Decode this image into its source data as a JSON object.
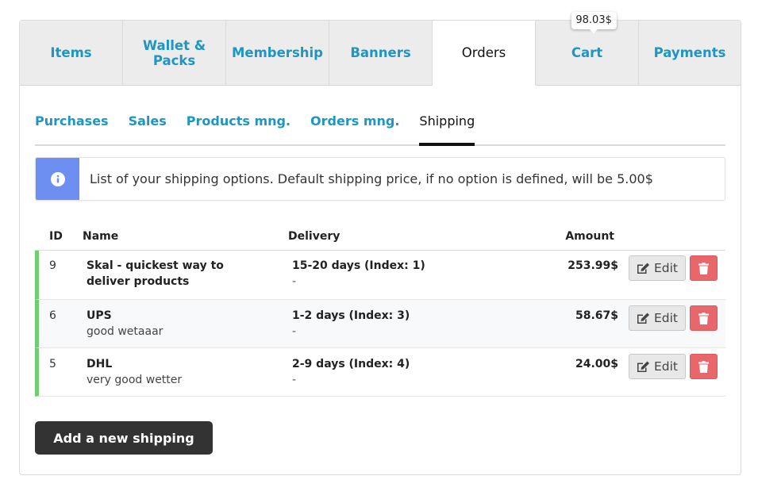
{
  "tabs": [
    {
      "label": "Items"
    },
    {
      "label": "Wallet & Packs"
    },
    {
      "label": "Membership"
    },
    {
      "label": "Banners"
    },
    {
      "label": "Orders"
    },
    {
      "label": "Cart"
    },
    {
      "label": "Payments"
    }
  ],
  "active_tab": "Orders",
  "cart_badge": "98.03$",
  "subtabs": [
    {
      "label": "Purchases"
    },
    {
      "label": "Sales"
    },
    {
      "label": "Products mng."
    },
    {
      "label": "Orders mng."
    },
    {
      "label": "Shipping"
    }
  ],
  "active_subtab": "Shipping",
  "info": {
    "icon": "info-circle-icon",
    "text": "List of your shipping options. Default shipping price, if no option is defined, will be 5.00$"
  },
  "table": {
    "headers": {
      "id": "ID",
      "name": "Name",
      "delivery": "Delivery",
      "amount": "Amount"
    },
    "rows": [
      {
        "id": "9",
        "name": "Skal - quickest way to deliver products",
        "description": "",
        "delivery": "15-20 days (Index: 1)",
        "delivery_note": "-",
        "amount": "253.99$"
      },
      {
        "id": "6",
        "name": "UPS",
        "description": "good wetaaar",
        "delivery": "1-2 days (Index: 3)",
        "delivery_note": "-",
        "amount": "58.67$"
      },
      {
        "id": "5",
        "name": "DHL",
        "description": "very good wetter",
        "delivery": "2-9 days (Index: 4)",
        "delivery_note": "-",
        "amount": "24.00$"
      }
    ],
    "edit_label": "Edit"
  },
  "add_button_label": "Add a new shipping",
  "colors": {
    "link": "#1e96c3",
    "info_accent": "#6e8ff2",
    "row_marker": "#6fce74",
    "delete": "#e8676a",
    "primary_button": "#333333"
  }
}
